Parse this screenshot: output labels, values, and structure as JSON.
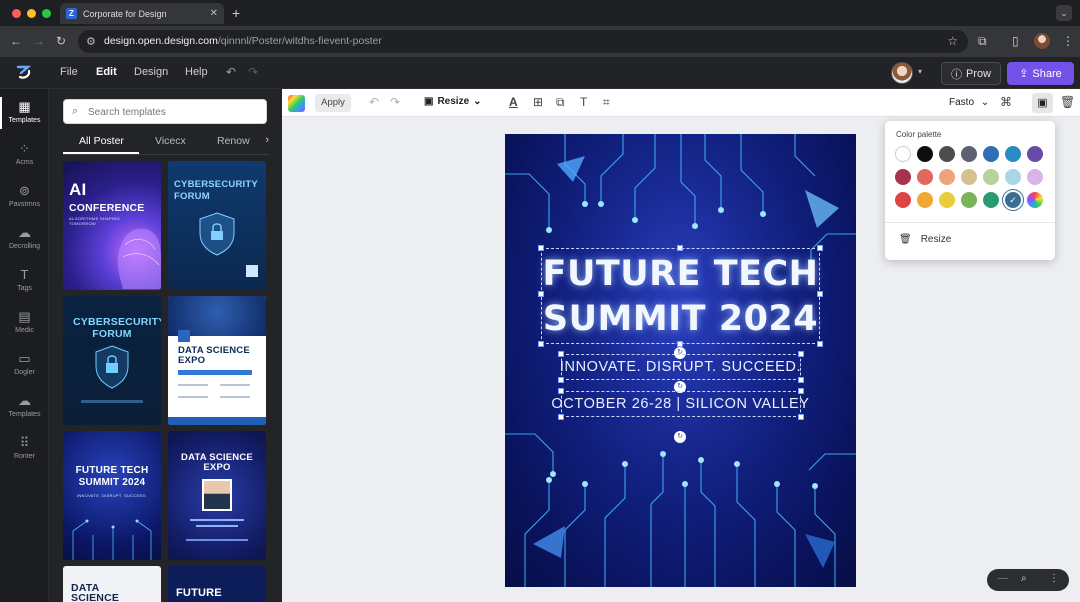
{
  "browser": {
    "tab_title": "Corporate for Design",
    "tab_favicon": "Z",
    "url_host": "design.open.design.com",
    "url_path": "/qinnnl/Poster/witdhs-fievent-poster"
  },
  "app": {
    "menu": [
      "File",
      "Edit",
      "Design",
      "Help"
    ],
    "active_menu": "Edit",
    "prow_label": "Prow",
    "share_label": "Share"
  },
  "rail": [
    {
      "label": "Templates",
      "icon": "templates-icon"
    },
    {
      "label": "Acms",
      "icon": "elements-icon"
    },
    {
      "label": "Pavstrnns",
      "icon": "photos-icon"
    },
    {
      "label": "Decrolling",
      "icon": "upload-icon"
    },
    {
      "label": "Tags",
      "icon": "text-icon"
    },
    {
      "label": "Medic",
      "icon": "media-icon"
    },
    {
      "label": "Dogler",
      "icon": "folder-icon"
    },
    {
      "label": "Templates",
      "icon": "cloud-icon"
    },
    {
      "label": "Ronter",
      "icon": "apps-icon"
    }
  ],
  "panel": {
    "search_placeholder": "Search templates",
    "tabs": [
      "All Poster",
      "Vicecx",
      "Renow"
    ],
    "cards": [
      {
        "title": "AI\nCONFERENCE",
        "sub": "ALGORITHMS SHAPING TOMORROW"
      },
      {
        "title": "CYBERSECURITY\nFORUM",
        "sub": ""
      },
      {
        "title": "CYBERSECURITY\nFORUM",
        "sub": ""
      },
      {
        "title": "DATA SCIENCE\nEXPO",
        "sub": ""
      },
      {
        "title": "FUTURE TECH\nSUMMIT 2024",
        "sub": "INNOVATE. DISRUPT. SUCCEED."
      },
      {
        "title": "DATA SCIENCE\nEXPO",
        "sub": ""
      },
      {
        "title": "DATA\nSCIENCE",
        "sub": ""
      },
      {
        "title": "FUTURE",
        "sub": ""
      }
    ]
  },
  "toolbar": {
    "apply_label": "Apply",
    "resize_label": "Resize",
    "font_label": "Fasto"
  },
  "poster": {
    "headline_line1": "FUTURE TECH",
    "headline_line2": "SUMMIT 2024",
    "tagline1": "INNOVATE. DISRUPT. SUCCEED.",
    "tagline2": "OCTOBER 26-28 | SILICON VALLEY"
  },
  "palette": {
    "title": "Color palette",
    "resize_label": "Resize",
    "colors": [
      [
        "#ffffff",
        "#0d0d0d",
        "#4d4d4d",
        "#5c6270",
        "#2f6fb3",
        "#2a8ac4",
        "#6a4aa8"
      ],
      [
        "#a8334d",
        "#e2675e",
        "#eea47a",
        "#d5c18f",
        "#b7d29b",
        "#a9d6e5",
        "#d8b4e8"
      ],
      [
        "#dd4444",
        "#f0a830",
        "#e8cc3a",
        "#7bb35a",
        "#2a9a72",
        "#3a6f95",
        "conic"
      ]
    ],
    "selected": "#3a6f95"
  }
}
